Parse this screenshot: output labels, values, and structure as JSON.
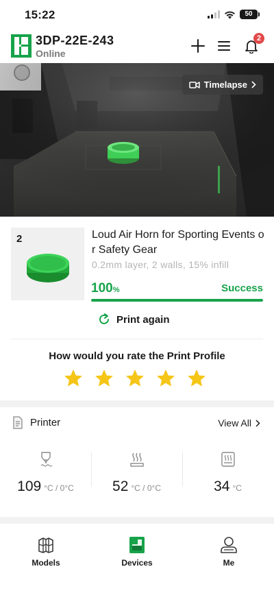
{
  "status_bar": {
    "time": "15:22",
    "battery": "50"
  },
  "header": {
    "device_name": "3DP-22E-243",
    "device_status": "Online",
    "notification_count": "2",
    "icons": [
      "add-icon",
      "menu-icon",
      "bell-icon"
    ]
  },
  "camera": {
    "timelapse_label": "Timelapse"
  },
  "print_job": {
    "thumb_index": "2",
    "model_name": "Loud Air Horn for Sporting Events or Safety Gear",
    "settings": "0.2mm layer, 2 walls, 15% infill",
    "progress_value": "100",
    "progress_unit": "%",
    "progress_fraction": 1.0,
    "status": "Success",
    "print_again_label": "Print again"
  },
  "rating": {
    "title": "How would you rate the Print Profile",
    "stars_filled": 5,
    "stars_total": 5
  },
  "printer": {
    "title": "Printer",
    "view_all_label": "View All",
    "temps": [
      {
        "name": "nozzle",
        "value": "109",
        "unit": "°C / 0°C",
        "icon": "nozzle-icon"
      },
      {
        "name": "bed",
        "value": "52",
        "unit": "°C / 0°C",
        "icon": "heatbed-icon"
      },
      {
        "name": "chamber",
        "value": "34",
        "unit": "°C",
        "icon": "chamber-icon"
      }
    ]
  },
  "bottom_nav": {
    "items": [
      {
        "label": "Models",
        "icon": "models-icon",
        "active": false
      },
      {
        "label": "Devices",
        "icon": "devices-icon",
        "active": true
      },
      {
        "label": "Me",
        "icon": "profile-icon",
        "active": false
      }
    ]
  },
  "colors": {
    "accent": "#17a34a",
    "star": "#f5c518",
    "badge": "#e34848",
    "muted": "#b4b4b4"
  }
}
